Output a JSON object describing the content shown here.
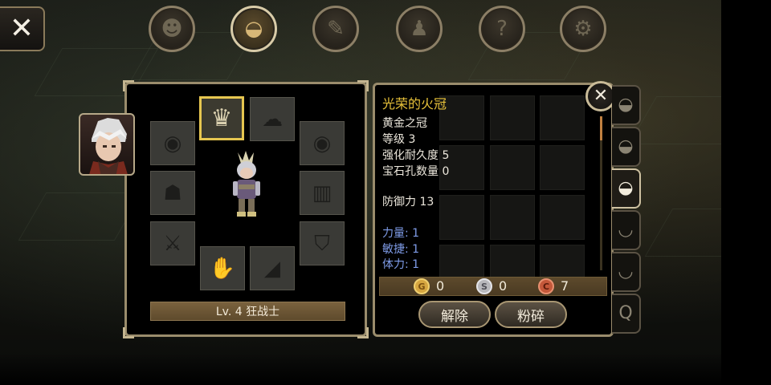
{
  "top_tabs": [
    {
      "id": "tab-character",
      "icon": "head-icon",
      "glyph": "☻",
      "active": false
    },
    {
      "id": "tab-inventory",
      "icon": "bag-icon",
      "glyph": "◒",
      "active": true
    },
    {
      "id": "tab-skills",
      "icon": "feather-icon",
      "glyph": "✎",
      "active": false
    },
    {
      "id": "tab-party",
      "icon": "people-icon",
      "glyph": "♟",
      "active": false
    },
    {
      "id": "tab-quest",
      "icon": "scroll-icon",
      "glyph": "?",
      "active": false
    },
    {
      "id": "tab-settings",
      "icon": "gear-icon",
      "glyph": "⚙",
      "active": false
    }
  ],
  "close_button": {
    "glyph": "✕"
  },
  "equipment": {
    "slots": [
      {
        "name": "helmet-slot",
        "icon": "crown-icon",
        "glyph": "♛",
        "selected": true
      },
      {
        "name": "cape-slot",
        "icon": "cape-icon",
        "glyph": "☁",
        "selected": false
      },
      {
        "name": "ring-left-slot",
        "icon": "ring-icon",
        "glyph": "◉",
        "selected": false
      },
      {
        "name": "ring-right-slot",
        "icon": "ring-icon",
        "glyph": "◉",
        "selected": false
      },
      {
        "name": "shoulder-slot",
        "icon": "pauldron-icon",
        "glyph": "☗",
        "selected": false
      },
      {
        "name": "armor-slot",
        "icon": "armor-icon",
        "glyph": "▥",
        "selected": false
      },
      {
        "name": "weapon-slot",
        "icon": "sword-icon",
        "glyph": "⚔",
        "selected": false
      },
      {
        "name": "shield-slot",
        "icon": "shield-icon",
        "glyph": "⛉",
        "selected": false
      },
      {
        "name": "gloves-slot",
        "icon": "gauntlet-icon",
        "glyph": "✋",
        "selected": false
      },
      {
        "name": "boots-slot",
        "icon": "boot-icon",
        "glyph": "◢",
        "selected": false
      }
    ],
    "level_label": "Lv. 4 狂战士"
  },
  "item_detail": {
    "name": "光荣的火冠",
    "stats": [
      {
        "text": "黄金之冠",
        "style": "normal"
      },
      {
        "text": "等级 3",
        "style": "normal"
      },
      {
        "text": "强化耐久度 5",
        "style": "normal"
      },
      {
        "text": "宝石孔数量 0",
        "style": "normal"
      },
      {
        "text": "防御力 13",
        "style": "normal"
      },
      {
        "text": "力量: 1",
        "style": "blue"
      },
      {
        "text": "敏捷: 1",
        "style": "blue"
      },
      {
        "text": "体力: 1",
        "style": "blue"
      }
    ],
    "currency": {
      "gold": {
        "letter": "G",
        "value": "0"
      },
      "silver": {
        "letter": "S",
        "value": "0"
      },
      "copper": {
        "letter": "C",
        "value": "7"
      }
    },
    "buttons": {
      "unequip": "解除",
      "smash": "粉碎"
    },
    "close_glyph": "✕"
  },
  "bag_tabs": [
    {
      "icon": "bag-icon",
      "glyph": "◒",
      "active": false
    },
    {
      "icon": "bag-icon",
      "glyph": "◒",
      "active": false
    },
    {
      "icon": "bag-icon",
      "glyph": "◒",
      "active": true
    },
    {
      "icon": "bag-outline-icon",
      "glyph": "◡",
      "active": false
    },
    {
      "icon": "bag-outline-icon",
      "glyph": "◡",
      "active": false
    },
    {
      "icon": "quest-bag-icon",
      "glyph": "Q",
      "active": false
    }
  ],
  "colors": {
    "item_name": "#e8c23a",
    "stat_bonus": "#7f9ce8",
    "panel_border": "#9a8c6c"
  }
}
